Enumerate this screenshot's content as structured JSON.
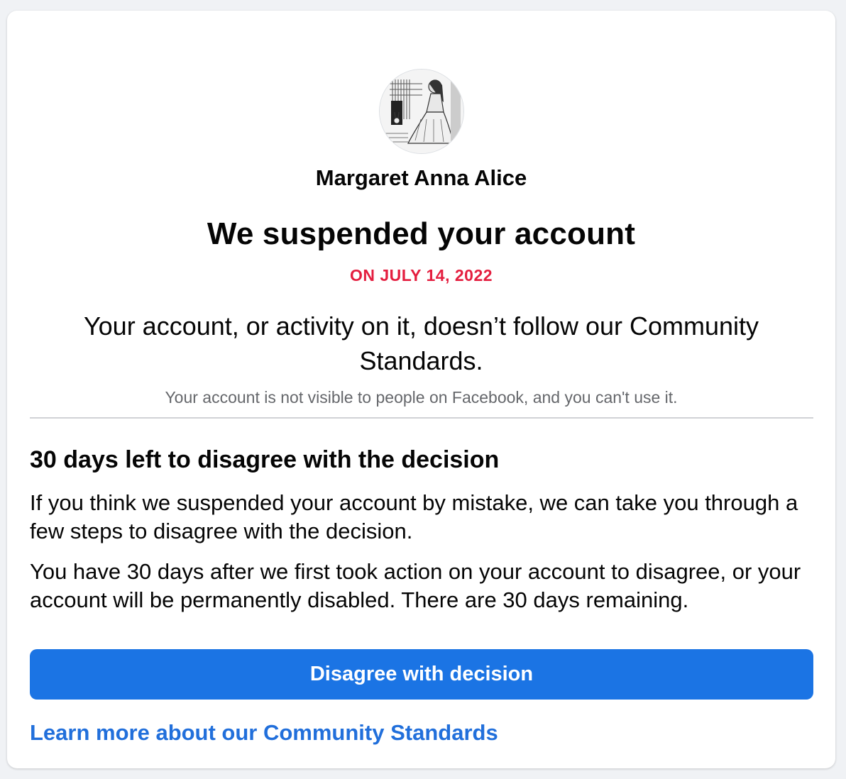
{
  "profile": {
    "name": "Margaret Anna Alice",
    "avatar_icon": "profile-illustration-icon"
  },
  "notice": {
    "title": "We suspended your account",
    "date": "ON JULY 14, 2022",
    "reason": "Your account, or activity on it, doesn’t follow our Community Standards.",
    "visibility": "Your account is not visible to people on Facebook, and you can't use it."
  },
  "appeal": {
    "heading": "30 days left to disagree with the decision",
    "paragraph1": "If you think we suspended your account by mistake, we can take you through a few steps to disagree with the decision.",
    "paragraph2": "You have 30 days after we first took action on your account to disagree, or your account will be permanently disabled. There are 30 days remaining.",
    "button_label": "Disagree with decision",
    "learn_more_label": "Learn more about our Community Standards"
  },
  "colors": {
    "accent_blue": "#1b74e4",
    "link_blue": "#216fdb",
    "alert_red": "#e41e3f",
    "secondary_text": "#65676b"
  }
}
